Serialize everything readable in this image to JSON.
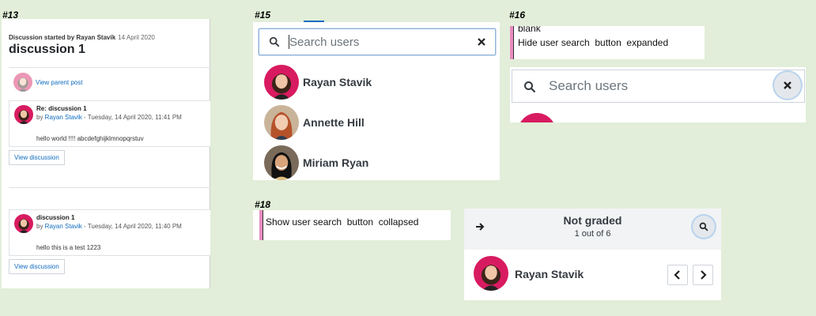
{
  "labels": {
    "l13": "#13",
    "l15": "#15",
    "l16": "#16",
    "l18": "#18"
  },
  "discussion": {
    "started_by": "Discussion started by Rayan Stavik",
    "date": "14 April 2020",
    "title": "discussion 1",
    "parent_link": "View parent post",
    "posts": [
      {
        "title": "Re: discussion 1",
        "by_prefix": "by ",
        "author": "Rayan Stavik",
        "when": " - Tuesday, 14 April 2020, 11:41 PM",
        "body": "hello world !!!! abcdefghijklmnopqrstuv",
        "button": "View discussion"
      },
      {
        "title": "discussion 1",
        "by_prefix": "by ",
        "author": "Rayan Stavik",
        "when": " - Tuesday, 14 April 2020, 11:40 PM",
        "body": "hello this is a test 1223",
        "button": "View discussion"
      }
    ]
  },
  "search15": {
    "placeholder": "Search users",
    "users": [
      {
        "name": "Rayan Stavik"
      },
      {
        "name": "Annette Hill"
      },
      {
        "name": "Miriam Ryan"
      }
    ]
  },
  "p16": {
    "line1": "blank",
    "line2": "Hide user search  button  expanded",
    "placeholder": "Search users"
  },
  "p18": {
    "line": "Show user search  button  collapsed"
  },
  "grader": {
    "title": "Not graded",
    "subtitle": "1 out of 6",
    "user_name": "Rayan Stavik"
  },
  "colors": {
    "link": "#0f6cbf",
    "background": "#e2eed9",
    "accent_pink": "#e88bc0"
  }
}
